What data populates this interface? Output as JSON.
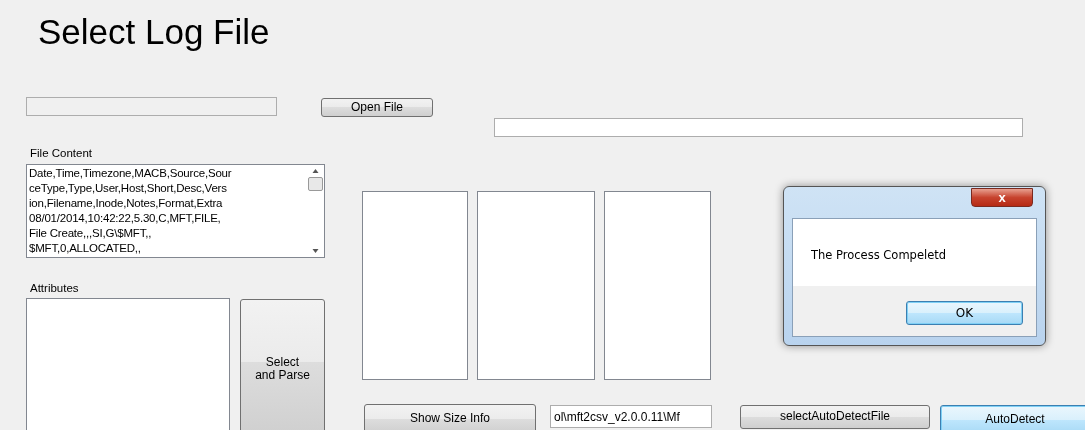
{
  "title": "Select Log File",
  "open_file_button": "Open File",
  "file_content": {
    "label": "File Content",
    "lines": [
      "Date,Time,Timezone,MACB,Source,Sour",
      "ceType,Type,User,Host,Short,Desc,Vers",
      "ion,Filename,Inode,Notes,Format,Extra",
      "08/01/2014,10:42:22,5.30,C,MFT,FILE,",
      "File Create,,,SI,G\\$MFT,,",
      "$MFT,0,ALLOCATED,,"
    ]
  },
  "attributes": {
    "label": "Attributes"
  },
  "select_parse_button": "Select and Parse",
  "show_size_button": "Show Size Info",
  "path_field": {
    "value": "ol\\mft2csv_v2.0.0.11\\Mf"
  },
  "select_auto_detect_button": "selectAutoDetectFile",
  "auto_detect_button": {
    "label": "AutoDetect",
    "focused": true
  },
  "dialog": {
    "message": "The Process Compeletd",
    "close": "x",
    "ok": "OK"
  }
}
